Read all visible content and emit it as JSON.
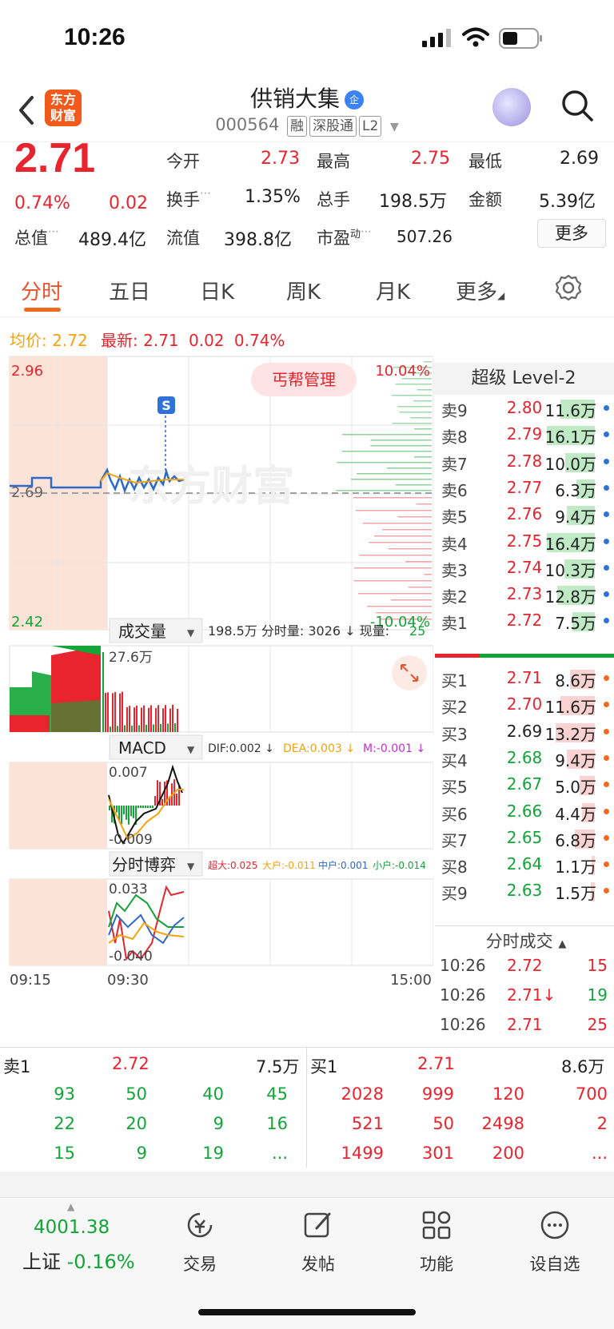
{
  "status_bar": {
    "time": "10:26"
  },
  "header": {
    "logo_text_1": "东方",
    "logo_text_2": "财富",
    "stock_name": "供销大集",
    "badge": "企",
    "code": "000564",
    "tags": [
      "融",
      "深股通",
      "L2"
    ]
  },
  "quote": {
    "price": "2.71",
    "change_pct": "0.74%",
    "change": "0.02",
    "open_label": "今开",
    "open": "2.73",
    "high_label": "最高",
    "high": "2.75",
    "low_label": "最低",
    "low": "2.69",
    "turnover_label": "换手",
    "turnover": "1.35%",
    "volume_label": "总手",
    "volume": "198.5万",
    "amount_label": "金额",
    "amount": "5.39亿",
    "mktcap_label": "总值",
    "mktcap": "489.4亿",
    "float_label": "流值",
    "float": "398.8亿",
    "pe_label": "市盈",
    "pe_sup": "动",
    "pe": "507.26",
    "more": "更多"
  },
  "tabs": [
    "分时",
    "五日",
    "日K",
    "周K",
    "月K",
    "更多"
  ],
  "avg_line": {
    "avg_label": "均价:",
    "avg": "2.72",
    "latest_label": "最新:",
    "latest": "2.71",
    "chg": "0.02",
    "pct": "0.74%"
  },
  "chart": {
    "y_top": "2.96",
    "y_mid": "2.69",
    "y_bottom": "2.42",
    "pct_top": "10.04%",
    "pct_bottom": "-10.04%",
    "watermark": "东方财富",
    "banner": "丐帮管理",
    "s_marker": "S",
    "vol_selector": "成交量",
    "vol_info": "198.5万 分时量: 3026 ↓ 现量:",
    "vol_now": "25",
    "vol_max": "27.6万",
    "macd_selector": "MACD",
    "macd_dif": "DIF:0.002 ↓",
    "macd_dea": "DEA:0.003 ↓",
    "macd_m": "M:-0.001 ↓",
    "macd_max": "0.007",
    "macd_min": "-0.009",
    "game_selector": "分时博弈",
    "game_big": "超大:0.025",
    "game_large": "大户:-0.011",
    "game_mid": "中户:0.001",
    "game_small": "小户:-0.014",
    "game_max": "0.033",
    "game_min": "-0.040",
    "t_start": "09:15",
    "t_open": "09:30",
    "t_end": "15:00"
  },
  "order_book": {
    "title": "超级 Level-2",
    "asks": [
      {
        "label": "卖9",
        "price": "2.80",
        "vol": "11.6万",
        "fill": 0.72
      },
      {
        "label": "卖8",
        "price": "2.79",
        "vol": "16.1万",
        "fill": 1.0
      },
      {
        "label": "卖7",
        "price": "2.78",
        "vol": "10.0万",
        "fill": 0.62
      },
      {
        "label": "卖6",
        "price": "2.77",
        "vol": "6.3万",
        "fill": 0.39
      },
      {
        "label": "卖5",
        "price": "2.76",
        "vol": "9.4万",
        "fill": 0.58
      },
      {
        "label": "卖4",
        "price": "2.75",
        "vol": "16.4万",
        "fill": 1.0
      },
      {
        "label": "卖3",
        "price": "2.74",
        "vol": "10.3万",
        "fill": 0.64
      },
      {
        "label": "卖2",
        "price": "2.73",
        "vol": "12.8万",
        "fill": 0.78
      },
      {
        "label": "卖1",
        "price": "2.72",
        "vol": "7.5万",
        "fill": 0.46
      }
    ],
    "bids": [
      {
        "label": "买1",
        "price": "2.71",
        "vol": "8.6万",
        "fill": 0.52
      },
      {
        "label": "买2",
        "price": "2.70",
        "vol": "11.6万",
        "fill": 0.71
      },
      {
        "label": "买3",
        "price": "2.69",
        "vol": "13.2万",
        "fill": 0.81
      },
      {
        "label": "买4",
        "price": "2.68",
        "vol": "9.4万",
        "fill": 0.58
      },
      {
        "label": "买5",
        "price": "2.67",
        "vol": "5.0万",
        "fill": 0.31
      },
      {
        "label": "买6",
        "price": "2.66",
        "vol": "4.4万",
        "fill": 0.27
      },
      {
        "label": "买7",
        "price": "2.65",
        "vol": "6.8万",
        "fill": 0.42
      },
      {
        "label": "买8",
        "price": "2.64",
        "vol": "1.1万",
        "fill": 0.07
      },
      {
        "label": "买9",
        "price": "2.63",
        "vol": "1.5万",
        "fill": 0.09
      }
    ]
  },
  "ticks": {
    "title": "分时成交",
    "rows": [
      {
        "time": "10:26",
        "price": "2.72",
        "vol": "15",
        "dir": "up"
      },
      {
        "time": "10:26",
        "price": "2.71↓",
        "vol": "19",
        "dir": "down"
      },
      {
        "time": "10:26",
        "price": "2.71",
        "vol": "25",
        "dir": "up"
      }
    ]
  },
  "depth": {
    "sell_label": "卖1",
    "sell_price": "2.72",
    "sell_vol": "7.5万",
    "buy_label": "买1",
    "buy_price": "2.71",
    "buy_vol": "8.6万",
    "sell_queue": [
      [
        "93",
        "50",
        "40",
        "45"
      ],
      [
        "22",
        "20",
        "9",
        "16"
      ],
      [
        "15",
        "9",
        "19",
        "..."
      ]
    ],
    "buy_queue": [
      [
        "2028",
        "999",
        "120",
        "700"
      ],
      [
        "521",
        "50",
        "2498",
        "2"
      ],
      [
        "1499",
        "301",
        "200",
        "..."
      ]
    ]
  },
  "bottom_nav": {
    "index_value": "4001.38",
    "index_name": "上证",
    "index_change": "-0.16%",
    "items": [
      "交易",
      "发帖",
      "功能",
      "设自选"
    ]
  }
}
